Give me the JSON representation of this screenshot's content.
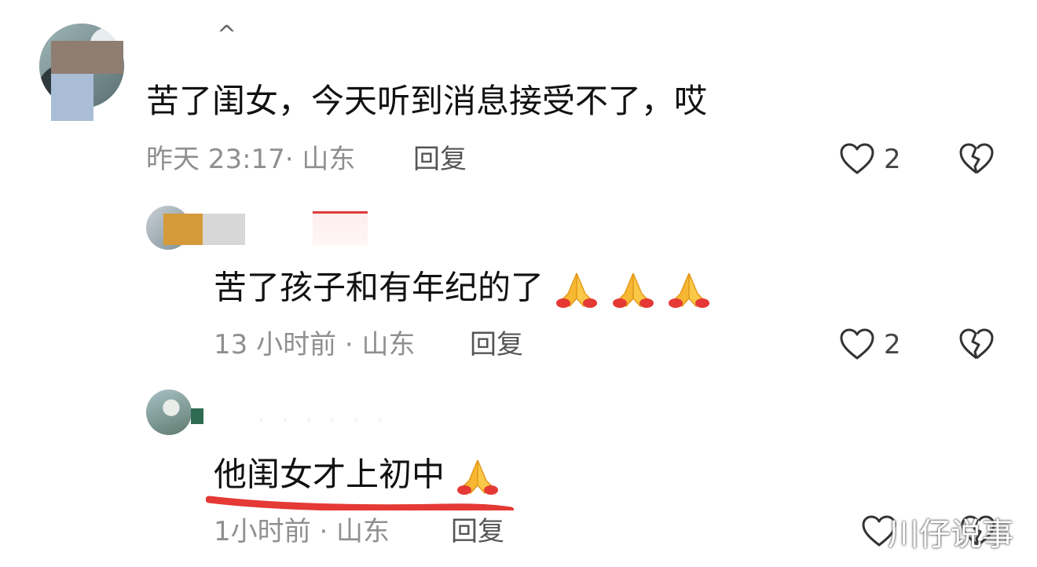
{
  "comments": [
    {
      "text": "苦了闺女，今天听到消息接受不了，哎",
      "meta": "昨天 23:17· 山东",
      "reply": "回复",
      "likes": "2"
    },
    {
      "text": "苦了孩子和有年纪的了",
      "emoji_count": 3,
      "meta": "13 小时前 · 山东",
      "reply": "回复",
      "likes": "2"
    },
    {
      "text": "他闺女才上初中",
      "emoji_count": 1,
      "meta": "1小时前 · 山东",
      "reply": "回复"
    }
  ],
  "icons": {
    "like": "heart-outline-icon",
    "dislike": "broken-heart-icon",
    "emoji": "folded-hands-emoji",
    "collapse": "caret-up-icon"
  },
  "watermark": "川仔说事",
  "colors": {
    "underline": "#e53935",
    "meta": "#8f8f8f"
  }
}
